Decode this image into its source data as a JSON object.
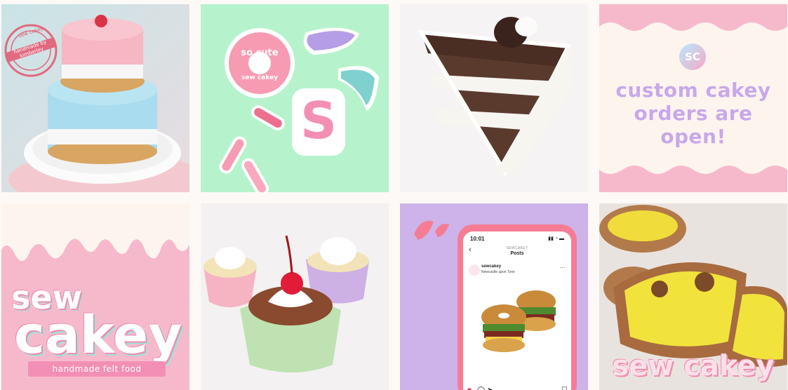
{
  "grid": {
    "tile_1": {
      "stamp_text": "handmade by kimberley",
      "stamp_ring": "sew cakey"
    },
    "tile_2": {
      "sticker_text_top": "so cute",
      "sticker_text_bottom": "sew cakey",
      "letter": "S"
    },
    "tile_3": {},
    "tile_4": {
      "badge": "SC",
      "lines": [
        "custom cakey",
        "orders are",
        "open!"
      ]
    },
    "tile_5": {
      "word_1": "sew",
      "word_2": "cakey",
      "ribbon": "handmade felt food"
    },
    "tile_6": {},
    "tile_7": {
      "phone": {
        "time": "10:01",
        "status_icons": "▮▮ ◔ ▬",
        "account_label": "SEWCAKEY",
        "title": "Posts",
        "username": "sewcakey",
        "location": "Newcastle upon Tyne",
        "back_glyph": "‹",
        "more_glyph": "···",
        "like_glyph": "♥",
        "comment_glyph": "◯",
        "share_glyph": "➤",
        "save_glyph": "⛉"
      }
    },
    "tile_8": {
      "watermark": "sew cakey"
    }
  },
  "colors": {
    "pink": "#f6b9cc",
    "mint": "#b6f3cc",
    "lavender": "#cdb3e9",
    "accent_pink": "#f67c94"
  }
}
